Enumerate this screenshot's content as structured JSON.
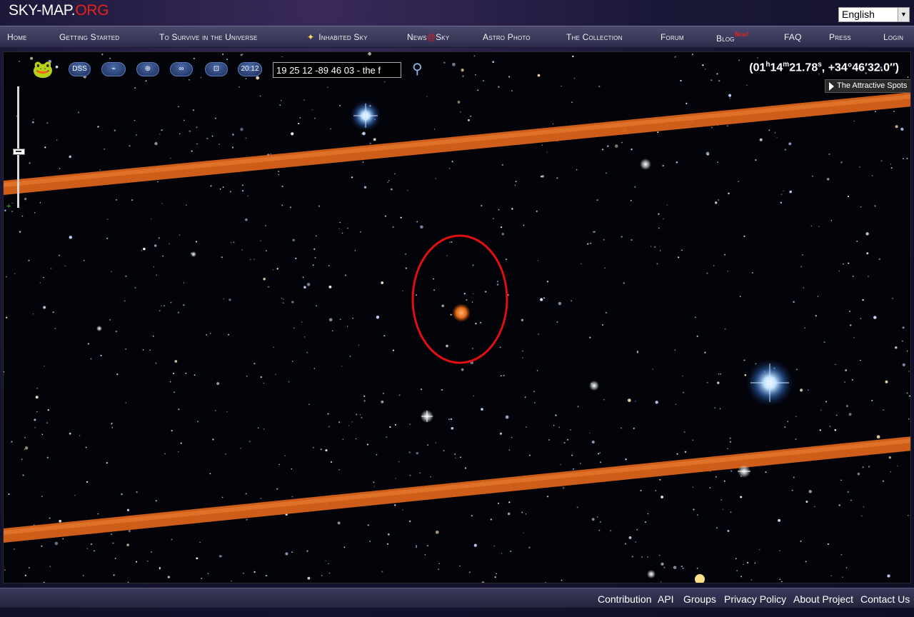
{
  "header": {
    "logo_part1": "SKY-MAP.",
    "logo_part2": "ORG",
    "language": "English"
  },
  "nav": [
    {
      "label": "Home"
    },
    {
      "label": "Getting Started"
    },
    {
      "label": "To Survive in the Universe"
    },
    {
      "label": "Inhabited Sky"
    },
    {
      "label_a": "News",
      "label_at": "@",
      "label_b": "Sky"
    },
    {
      "label": "Astro Photo"
    },
    {
      "label": "The Collection"
    },
    {
      "label": "Forum"
    },
    {
      "label": "Blog",
      "badge": "New!"
    },
    {
      "label": "FAQ"
    },
    {
      "label": "Press"
    },
    {
      "label": "Login"
    }
  ],
  "toolbar": {
    "dss_label": "DSS",
    "time_label": "20:12",
    "search_value": "19 25 12 -89 46 03 - the f"
  },
  "coords": {
    "ra_h": "01",
    "ra_m": "14",
    "ra_s": "21.78",
    "dec": ", +34°46′32.0″)"
  },
  "attractive_spots": "The Attractive Spots",
  "colors": {
    "accent_red": "#e8201e",
    "orange_band": "#d9621a",
    "circle": "#e01010"
  },
  "footer": [
    "Contribution",
    "API",
    "Groups",
    "Privacy Policy",
    "About Project",
    "Contact Us"
  ]
}
